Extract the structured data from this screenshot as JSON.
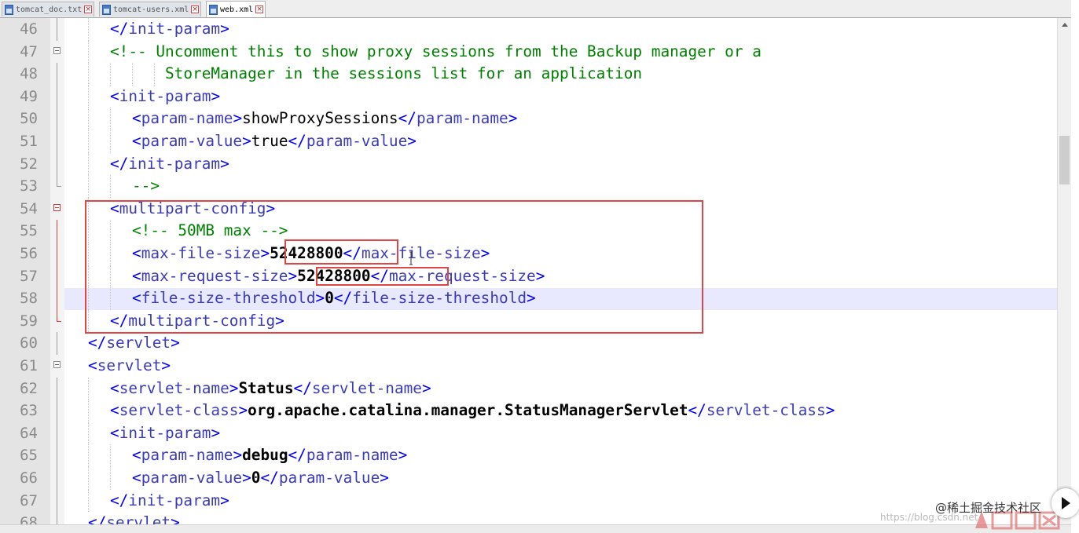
{
  "tabs": [
    {
      "label": "tomcat_doc.txt",
      "active": false
    },
    {
      "label": "tomcat-users.xml",
      "active": false
    },
    {
      "label": "web.xml",
      "active": true
    }
  ],
  "tab_close_glyph": "×",
  "icons": {
    "file": "file-icon",
    "close": "close-icon",
    "fold": "fold-icon",
    "play": "play-icon",
    "text_cursor": "text-cursor-icon"
  },
  "colors": {
    "tag_bracket": "#0000ff",
    "tag_name": "#3b3bb8",
    "comment": "#008000",
    "text": "#000000",
    "current_line": "#e8e8ff",
    "annotation": "#e04646"
  },
  "lines": [
    {
      "num": "46",
      "tokens": [
        {
          "t": "</",
          "c": "tag"
        },
        {
          "t": "init-param",
          "c": "tag-name"
        },
        {
          "t": ">",
          "c": "tag"
        }
      ]
    },
    {
      "num": "47",
      "tokens": [
        {
          "t": "<!-- Uncomment this to show proxy sessions from the Backup manager or a",
          "c": "comment"
        }
      ]
    },
    {
      "num": "48",
      "tokens": [
        {
          "t": "StoreManager in the sessions list for an application",
          "c": "comment"
        }
      ]
    },
    {
      "num": "49",
      "tokens": [
        {
          "t": "<",
          "c": "tag"
        },
        {
          "t": "init-param",
          "c": "tag-name"
        },
        {
          "t": ">",
          "c": "tag"
        }
      ]
    },
    {
      "num": "50",
      "tokens": [
        {
          "t": "<",
          "c": "tag"
        },
        {
          "t": "param-name",
          "c": "tag-name"
        },
        {
          "t": ">",
          "c": "tag"
        },
        {
          "t": "showProxySessions",
          "c": "txt"
        },
        {
          "t": "</",
          "c": "tag"
        },
        {
          "t": "param-name",
          "c": "tag-name"
        },
        {
          "t": ">",
          "c": "tag"
        }
      ]
    },
    {
      "num": "51",
      "tokens": [
        {
          "t": "<",
          "c": "tag"
        },
        {
          "t": "param-value",
          "c": "tag-name"
        },
        {
          "t": ">",
          "c": "tag"
        },
        {
          "t": "true",
          "c": "txt"
        },
        {
          "t": "</",
          "c": "tag"
        },
        {
          "t": "param-value",
          "c": "tag-name"
        },
        {
          "t": ">",
          "c": "tag"
        }
      ]
    },
    {
      "num": "52",
      "tokens": [
        {
          "t": "</",
          "c": "tag"
        },
        {
          "t": "init-param",
          "c": "tag-name"
        },
        {
          "t": ">",
          "c": "tag"
        }
      ]
    },
    {
      "num": "53",
      "tokens": [
        {
          "t": "-->",
          "c": "comment"
        }
      ]
    },
    {
      "num": "54",
      "tokens": [
        {
          "t": "<",
          "c": "tag"
        },
        {
          "t": "multipart-config",
          "c": "tag-name"
        },
        {
          "t": ">",
          "c": "tag"
        }
      ]
    },
    {
      "num": "55",
      "tokens": [
        {
          "t": "<!-- 50MB max -->",
          "c": "comment"
        }
      ]
    },
    {
      "num": "56",
      "tokens": [
        {
          "t": "<",
          "c": "tag"
        },
        {
          "t": "max-file-size",
          "c": "tag-name"
        },
        {
          "t": ">",
          "c": "tag"
        },
        {
          "t": "52428800",
          "c": "txt-b"
        },
        {
          "t": "</",
          "c": "tag"
        },
        {
          "t": "max-file-size",
          "c": "tag-name"
        },
        {
          "t": ">",
          "c": "tag"
        }
      ]
    },
    {
      "num": "57",
      "tokens": [
        {
          "t": "<",
          "c": "tag"
        },
        {
          "t": "max-request-size",
          "c": "tag-name"
        },
        {
          "t": ">",
          "c": "tag"
        },
        {
          "t": "52428800",
          "c": "txt-b"
        },
        {
          "t": "</",
          "c": "tag"
        },
        {
          "t": "max-request-size",
          "c": "tag-name"
        },
        {
          "t": ">",
          "c": "tag"
        }
      ]
    },
    {
      "num": "58",
      "tokens": [
        {
          "t": "<",
          "c": "tag"
        },
        {
          "t": "file-size-threshold",
          "c": "tag-name"
        },
        {
          "t": ">",
          "c": "tag"
        },
        {
          "t": "0",
          "c": "txt-b"
        },
        {
          "t": "</",
          "c": "tag"
        },
        {
          "t": "file-size-threshold",
          "c": "tag-name"
        },
        {
          "t": ">",
          "c": "tag"
        }
      ]
    },
    {
      "num": "59",
      "tokens": [
        {
          "t": "</",
          "c": "tag"
        },
        {
          "t": "multipart-config",
          "c": "tag-name"
        },
        {
          "t": ">",
          "c": "tag"
        }
      ]
    },
    {
      "num": "60",
      "tokens": [
        {
          "t": "</",
          "c": "tag"
        },
        {
          "t": "servlet",
          "c": "tag-name"
        },
        {
          "t": ">",
          "c": "tag"
        }
      ]
    },
    {
      "num": "61",
      "tokens": [
        {
          "t": "<",
          "c": "tag"
        },
        {
          "t": "servlet",
          "c": "tag-name"
        },
        {
          "t": ">",
          "c": "tag"
        }
      ]
    },
    {
      "num": "62",
      "tokens": [
        {
          "t": "<",
          "c": "tag"
        },
        {
          "t": "servlet-name",
          "c": "tag-name"
        },
        {
          "t": ">",
          "c": "tag"
        },
        {
          "t": "Status",
          "c": "txt-b"
        },
        {
          "t": "</",
          "c": "tag"
        },
        {
          "t": "servlet-name",
          "c": "tag-name"
        },
        {
          "t": ">",
          "c": "tag"
        }
      ]
    },
    {
      "num": "63",
      "tokens": [
        {
          "t": "<",
          "c": "tag"
        },
        {
          "t": "servlet-class",
          "c": "tag-name"
        },
        {
          "t": ">",
          "c": "tag"
        },
        {
          "t": "org.apache.catalina.manager.StatusManagerServlet",
          "c": "txt-b"
        },
        {
          "t": "</",
          "c": "tag"
        },
        {
          "t": "servlet-class",
          "c": "tag-name"
        },
        {
          "t": ">",
          "c": "tag"
        }
      ]
    },
    {
      "num": "64",
      "tokens": [
        {
          "t": "<",
          "c": "tag"
        },
        {
          "t": "init-param",
          "c": "tag-name"
        },
        {
          "t": ">",
          "c": "tag"
        }
      ]
    },
    {
      "num": "65",
      "tokens": [
        {
          "t": "<",
          "c": "tag"
        },
        {
          "t": "param-name",
          "c": "tag-name"
        },
        {
          "t": ">",
          "c": "tag"
        },
        {
          "t": "debug",
          "c": "txt-b"
        },
        {
          "t": "</",
          "c": "tag"
        },
        {
          "t": "param-name",
          "c": "tag-name"
        },
        {
          "t": ">",
          "c": "tag"
        }
      ]
    },
    {
      "num": "66",
      "tokens": [
        {
          "t": "<",
          "c": "tag"
        },
        {
          "t": "param-value",
          "c": "tag-name"
        },
        {
          "t": ">",
          "c": "tag"
        },
        {
          "t": "0",
          "c": "txt-b"
        },
        {
          "t": "</",
          "c": "tag"
        },
        {
          "t": "param-value",
          "c": "tag-name"
        },
        {
          "t": ">",
          "c": "tag"
        }
      ]
    },
    {
      "num": "67",
      "tokens": [
        {
          "t": "</",
          "c": "tag"
        },
        {
          "t": "init-param",
          "c": "tag-name"
        },
        {
          "t": ">",
          "c": "tag"
        }
      ]
    },
    {
      "num": "68",
      "tokens": [
        {
          "t": "</",
          "c": "tag"
        },
        {
          "t": "servlet",
          "c": "tag-name"
        },
        {
          "t": ">",
          "c": "tag"
        }
      ]
    }
  ],
  "watermark": {
    "community": "@稀土掘金技术社区",
    "url": "https://blog.csdn.net"
  }
}
